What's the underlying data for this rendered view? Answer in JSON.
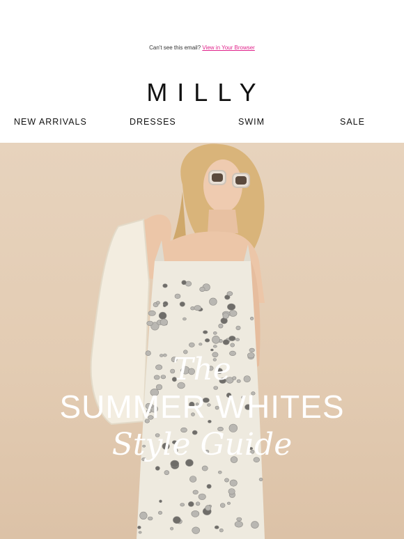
{
  "preheader": {
    "text": "Can't see this email?",
    "link": "View in Your Browser"
  },
  "brand": {
    "logo": "MILLY"
  },
  "nav": {
    "items": [
      "NEW ARRIVALS",
      "DRESSES",
      "SWIM",
      "SALE"
    ]
  },
  "hero": {
    "line1": "The",
    "line2": "SUMMER WHITES",
    "line3": "Style Guide"
  },
  "colors": {
    "accent_link": "#e0218a",
    "hero_background": "#e5cfb7",
    "text": "#111111"
  }
}
